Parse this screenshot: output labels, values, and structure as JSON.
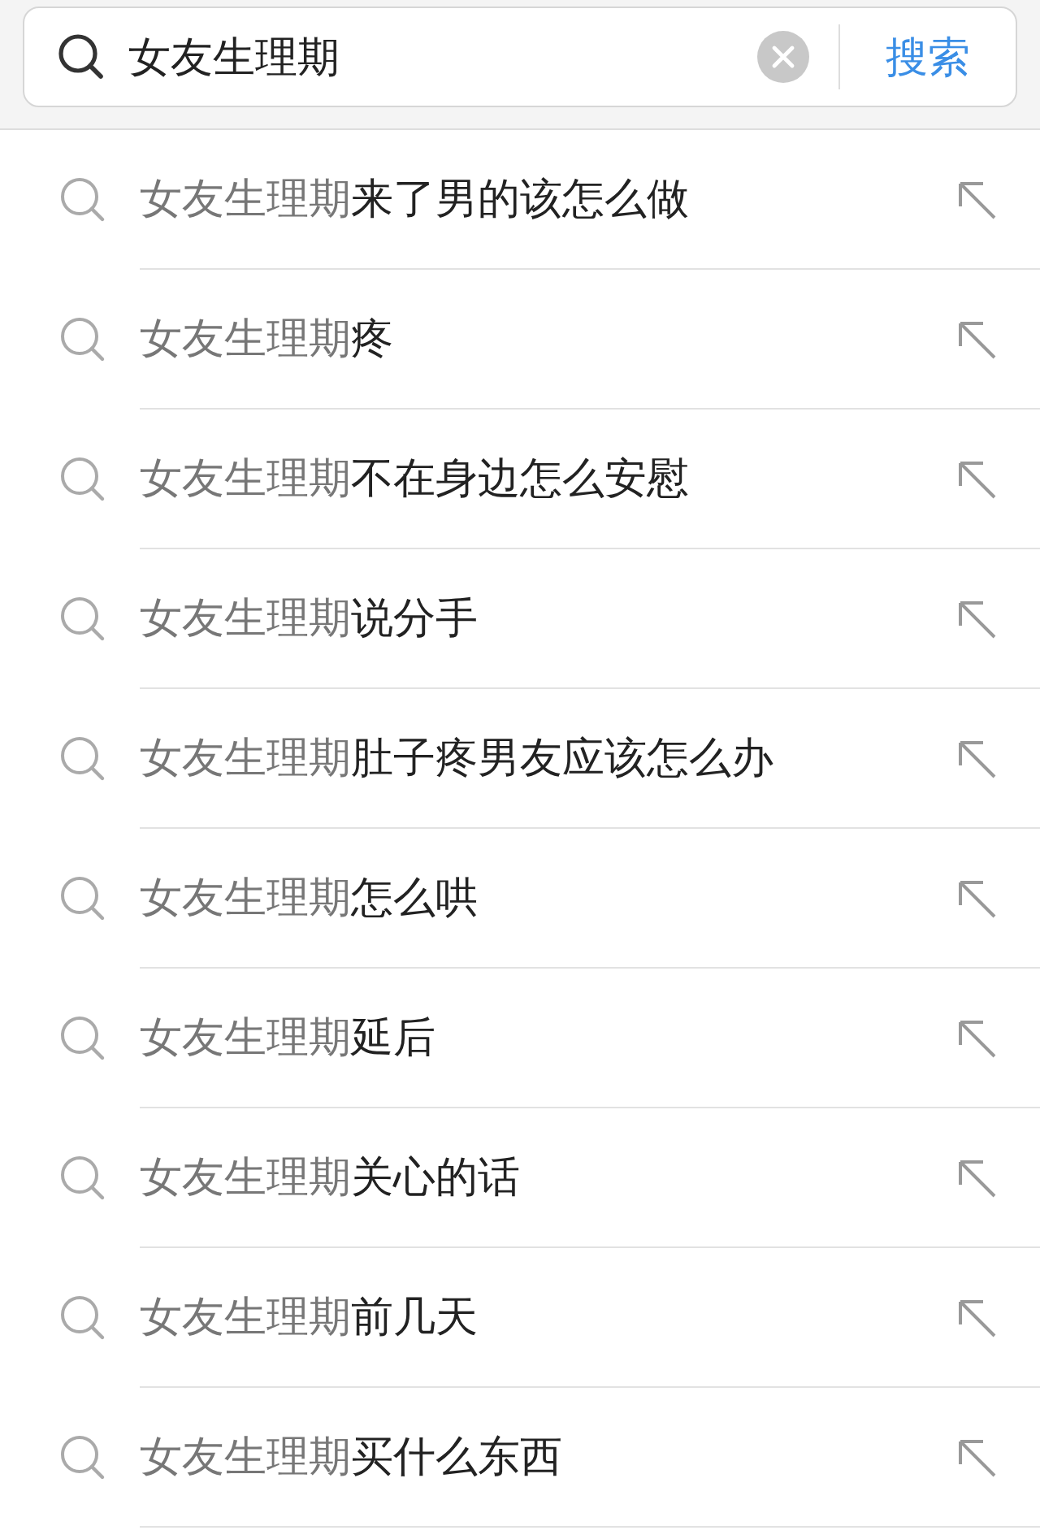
{
  "search": {
    "value": "女友生理期",
    "button": "搜索"
  },
  "suggestions": [
    {
      "match": "女友生理期",
      "rest": "来了男的该怎么做"
    },
    {
      "match": "女友生理期",
      "rest": "疼"
    },
    {
      "match": "女友生理期",
      "rest": "不在身边怎么安慰"
    },
    {
      "match": "女友生理期",
      "rest": "说分手"
    },
    {
      "match": "女友生理期",
      "rest": "肚子疼男友应该怎么办"
    },
    {
      "match": "女友生理期",
      "rest": "怎么哄"
    },
    {
      "match": "女友生理期",
      "rest": "延后"
    },
    {
      "match": "女友生理期",
      "rest": "关心的话"
    },
    {
      "match": "女友生理期",
      "rest": "前几天"
    },
    {
      "match": "女友生理期",
      "rest": "买什么东西"
    }
  ]
}
